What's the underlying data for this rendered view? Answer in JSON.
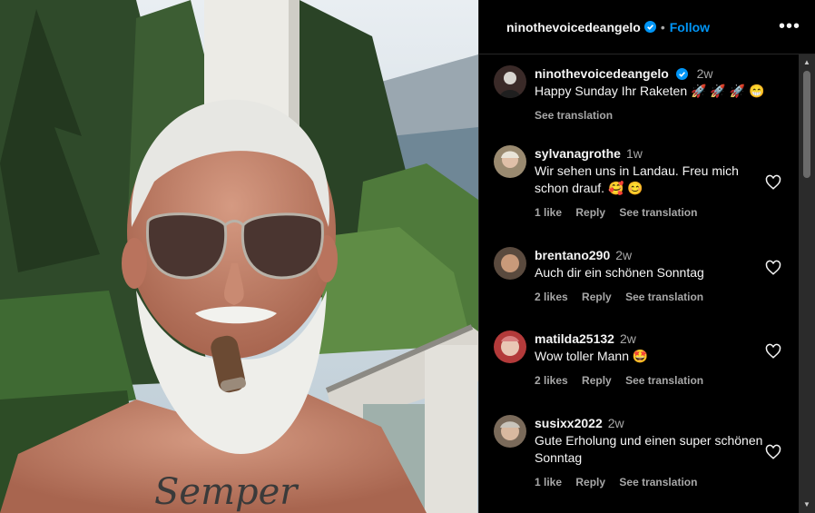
{
  "post": {
    "username": "ninothevoicedeangelo",
    "follow_label": "Follow",
    "separator": "•",
    "more_label": "•••"
  },
  "caption": {
    "username": "ninothevoicedeangelo",
    "time": "2w",
    "text": "Happy Sunday Ihr Raketen 🚀 🚀 🚀 😁",
    "see_translation": "See translation"
  },
  "comments": [
    {
      "username": "sylvanagrothe",
      "time": "1w",
      "text": "Wir sehen uns in Landau. Freu mich schon drauf. 🥰 😊",
      "likes": "1 like",
      "reply": "Reply",
      "see_translation": "See translation"
    },
    {
      "username": "brentano290",
      "time": "2w",
      "text": "Auch dir ein schönen Sonntag",
      "likes": "2 likes",
      "reply": "Reply",
      "see_translation": "See translation"
    },
    {
      "username": "matilda25132",
      "time": "2w",
      "text": "Wow toller Mann 🤩",
      "likes": "2 likes",
      "reply": "Reply",
      "see_translation": "See translation"
    },
    {
      "username": "susixx2022",
      "time": "2w",
      "text": "Gute Erholung und einen super schönen Sonntag",
      "likes": "1 like",
      "reply": "Reply",
      "see_translation": "See translation"
    }
  ],
  "photo": {
    "tattoo_text": "Semper"
  },
  "colors": {
    "accent": "#0095f6",
    "verified": "#0095f6",
    "muted": "#a8a8a8"
  },
  "icons": {
    "verified": "verified-badge-icon",
    "heart": "heart-outline-icon",
    "more": "more-options-icon"
  }
}
